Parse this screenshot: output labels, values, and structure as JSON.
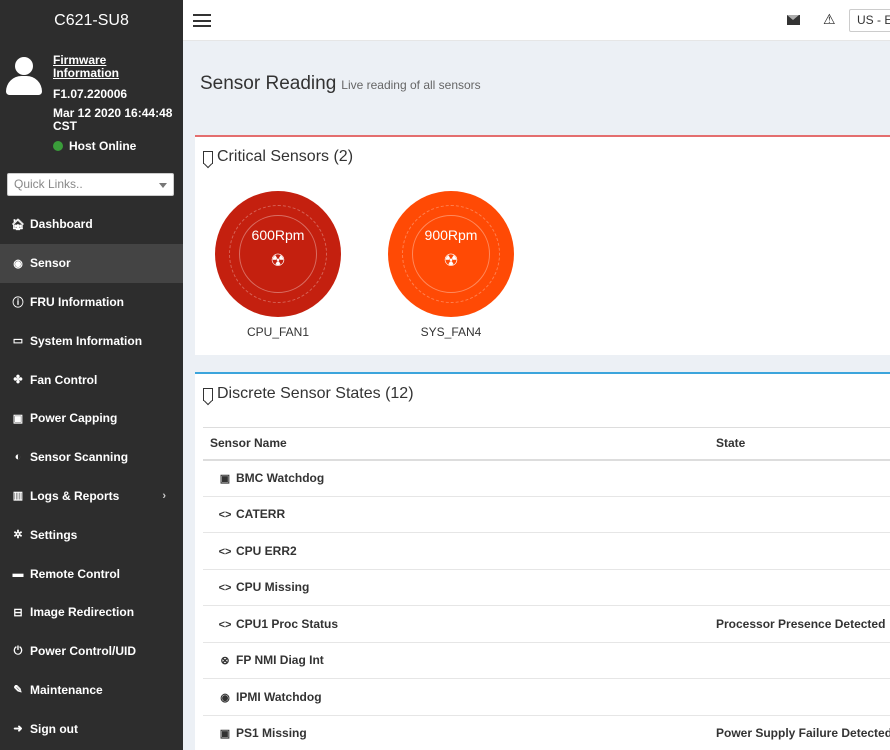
{
  "sidebar": {
    "brand": "C621-SU8",
    "firmware_link": "Firmware Information",
    "firmware_version": "F1.07.220006",
    "firmware_date": "Mar 12 2020 16:44:48 CST",
    "host_status": "Host Online",
    "host_status_color": "#3a9d3a",
    "quick_links_placeholder": "Quick Links..",
    "items": [
      {
        "label": "Dashboard",
        "icon": "dashboard-icon"
      },
      {
        "label": "Sensor",
        "icon": "sensor-icon",
        "active": true
      },
      {
        "label": "FRU Information",
        "icon": "info-icon"
      },
      {
        "label": "System Information",
        "icon": "laptop-icon"
      },
      {
        "label": "Fan Control",
        "icon": "fan-icon"
      },
      {
        "label": "Power Capping",
        "icon": "power-capping-icon"
      },
      {
        "label": "Sensor Scanning",
        "icon": "toggle-icon"
      },
      {
        "label": "Logs & Reports",
        "icon": "chart-icon",
        "has_submenu": true
      },
      {
        "label": "Settings",
        "icon": "gear-icon"
      },
      {
        "label": "Remote Control",
        "icon": "monitor-icon"
      },
      {
        "label": "Image Redirection",
        "icon": "disk-icon"
      },
      {
        "label": "Power Control/UID",
        "icon": "power-icon"
      },
      {
        "label": "Maintenance",
        "icon": "wrench-icon"
      },
      {
        "label": "Sign out",
        "icon": "sign-out-icon"
      }
    ]
  },
  "topbar": {
    "language": "US - En"
  },
  "page": {
    "title": "Sensor Reading",
    "subtitle": "Live reading of all sensors"
  },
  "critical": {
    "title": "Critical Sensors (2)",
    "accent": "#e46e6e",
    "sensors": [
      {
        "value": "600Rpm",
        "name": "CPU_FAN1",
        "color": "#c4200f"
      },
      {
        "value": "900Rpm",
        "name": "SYS_FAN4",
        "color": "#ff4a05"
      }
    ]
  },
  "discrete": {
    "title": "Discrete Sensor States (12)",
    "accent": "#3ca5dc",
    "columns": [
      "Sensor Name",
      "State"
    ],
    "rows": [
      {
        "name": "BMC Watchdog",
        "state": "",
        "icon": "watchdog-icon"
      },
      {
        "name": "CATERR",
        "state": "",
        "icon": "code-icon"
      },
      {
        "name": "CPU ERR2",
        "state": "",
        "icon": "code-icon"
      },
      {
        "name": "CPU Missing",
        "state": "",
        "icon": "code-icon"
      },
      {
        "name": "CPU1 Proc Status",
        "state": "Processor Presence Detected",
        "icon": "code-icon"
      },
      {
        "name": "FP NMI Diag Int",
        "state": "",
        "icon": "close-circle-icon"
      },
      {
        "name": "IPMI Watchdog",
        "state": "",
        "icon": "eye-icon"
      },
      {
        "name": "PS1 Missing",
        "state": "Power Supply Failure Detected",
        "icon": "power-supply-icon"
      }
    ]
  }
}
